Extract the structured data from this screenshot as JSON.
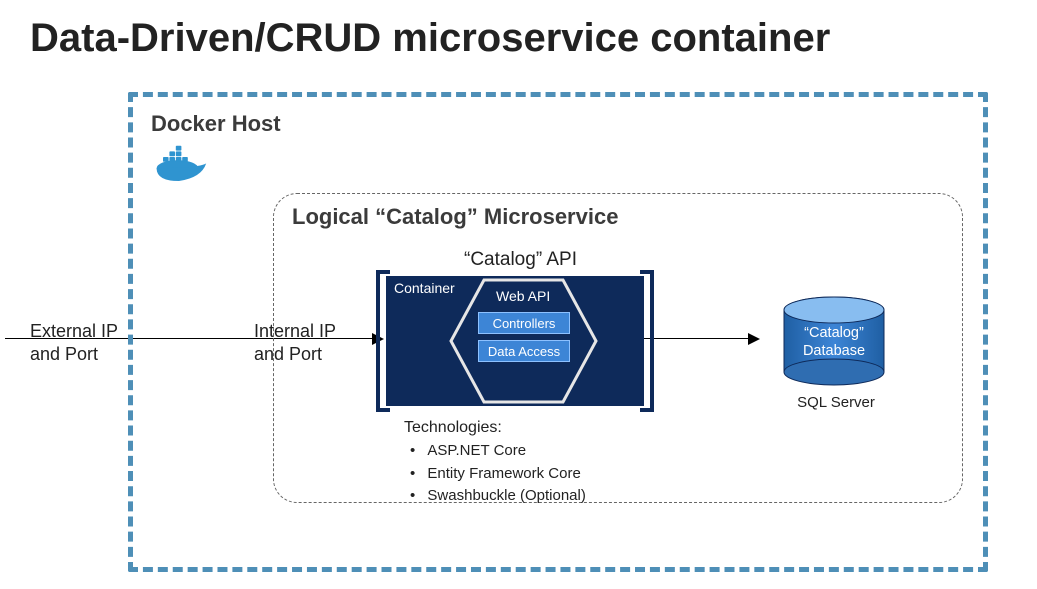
{
  "title": "Data-Driven/CRUD microservice container",
  "dockerHost": {
    "label": "Docker Host"
  },
  "logical": {
    "label": "Logical “Catalog” Microservice"
  },
  "catalogApi": {
    "label": "“Catalog” API"
  },
  "container": {
    "label": "Container",
    "webApiLabel": "Web API",
    "controllers": "Controllers",
    "dataAccess": "Data Access"
  },
  "technologies": {
    "title": "Technologies:",
    "items": [
      "ASP.NET Core",
      "Entity Framework Core",
      "Swashbuckle (Optional)"
    ]
  },
  "database": {
    "nameLine1": "“Catalog”",
    "nameLine2": "Database",
    "caption": "SQL Server"
  },
  "externalIp": {
    "line1": "External IP",
    "line2": "and Port"
  },
  "internalIp": {
    "line1": "Internal IP",
    "line2": "and Port"
  },
  "colors": {
    "accentBlue": "#4e8fb7",
    "navy": "#0e2a5a",
    "midBlue": "#3d85d6",
    "dbBlue": "#2f6db1"
  }
}
